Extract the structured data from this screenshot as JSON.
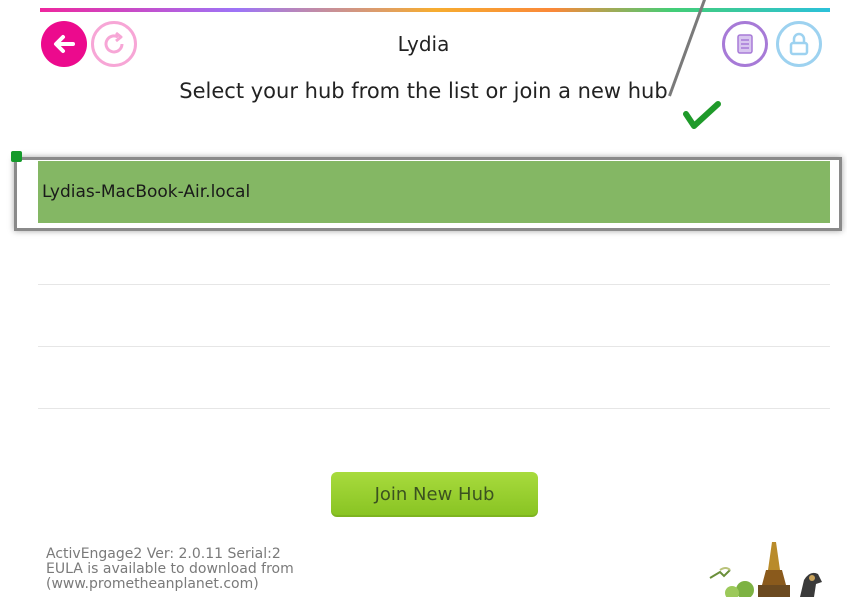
{
  "header": {
    "title": "Lydia",
    "back_icon": "arrow-left-icon",
    "refresh_icon": "refresh-icon",
    "list_icon": "list-icon",
    "lock_icon": "lock-icon"
  },
  "instruction": "Select your hub from the list or join a new hub",
  "hub_list": {
    "items": [
      {
        "label": "Lydias-MacBook-Air.local",
        "selected": true
      },
      {
        "label": ""
      },
      {
        "label": ""
      },
      {
        "label": ""
      }
    ]
  },
  "join_button": {
    "label": "Join New Hub"
  },
  "footer": {
    "line1": "ActivEngage2 Ver: 2.0.11 Serial:2",
    "line2": "EULA is available to download from",
    "line3": "(www.prometheanplanet.com)"
  },
  "colors": {
    "accent_pink": "#ec0a8d",
    "selected_row": "#84b764",
    "join_button": "#98cf2c",
    "annotation_green": "#159a2b"
  }
}
